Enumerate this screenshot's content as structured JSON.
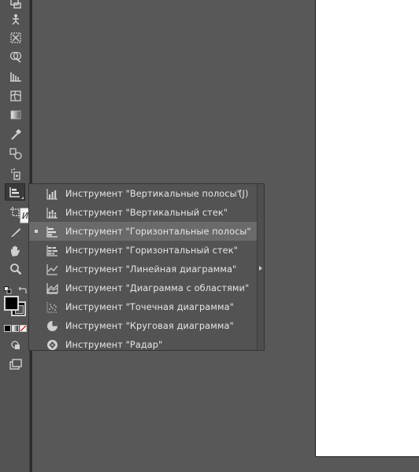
{
  "toolbar": {
    "tooltip_text": "И",
    "tools": [
      {
        "name": "artboard-tool-icon"
      },
      {
        "name": "puppet-warp-tool-icon"
      },
      {
        "name": "free-transform-tool-icon"
      },
      {
        "name": "shape-builder-tool-icon"
      },
      {
        "name": "perspective-grid-tool-icon"
      },
      {
        "name": "mesh-tool-icon"
      },
      {
        "name": "gradient-tool-icon"
      },
      {
        "name": "eyedropper-tool-icon"
      },
      {
        "name": "blend-tool-icon"
      },
      {
        "name": "symbol-sprayer-tool-icon"
      },
      {
        "name": "column-graph-tool-icon"
      },
      {
        "name": "artboard-crop-tool-icon"
      },
      {
        "name": "slice-tool-icon"
      },
      {
        "name": "hand-tool-icon"
      },
      {
        "name": "zoom-tool-icon"
      }
    ]
  },
  "flyout": {
    "items": [
      {
        "label": "Инструмент \"Вертикальные полосы\"",
        "shortcut": "(J)",
        "icon": "column-graph-icon"
      },
      {
        "label": "Инструмент \"Вертикальный стек\"",
        "shortcut": "",
        "icon": "stacked-column-graph-icon"
      },
      {
        "label": "Инструмент \"Горизонтальные полосы\"",
        "shortcut": "",
        "icon": "bar-graph-icon"
      },
      {
        "label": "Инструмент \"Горизонтальный стек\"",
        "shortcut": "",
        "icon": "stacked-bar-graph-icon"
      },
      {
        "label": "Инструмент \"Линейная диаграмма\"",
        "shortcut": "",
        "icon": "line-graph-icon"
      },
      {
        "label": "Инструмент \"Диаграмма с областями\"",
        "shortcut": "",
        "icon": "area-graph-icon"
      },
      {
        "label": "Инструмент \"Точечная диаграмма\"",
        "shortcut": "",
        "icon": "scatter-graph-icon"
      },
      {
        "label": "Инструмент \"Круговая диаграмма\"",
        "shortcut": "",
        "icon": "pie-graph-icon"
      },
      {
        "label": "Инструмент \"Радар\"",
        "shortcut": "",
        "icon": "radar-graph-icon"
      }
    ],
    "selected_index": 2
  },
  "colors": {
    "workspace": "#585858",
    "panel": "#535353",
    "highlight": "#6a6a6a",
    "text": "#e6e6e6",
    "artboard": "#ffffff"
  }
}
